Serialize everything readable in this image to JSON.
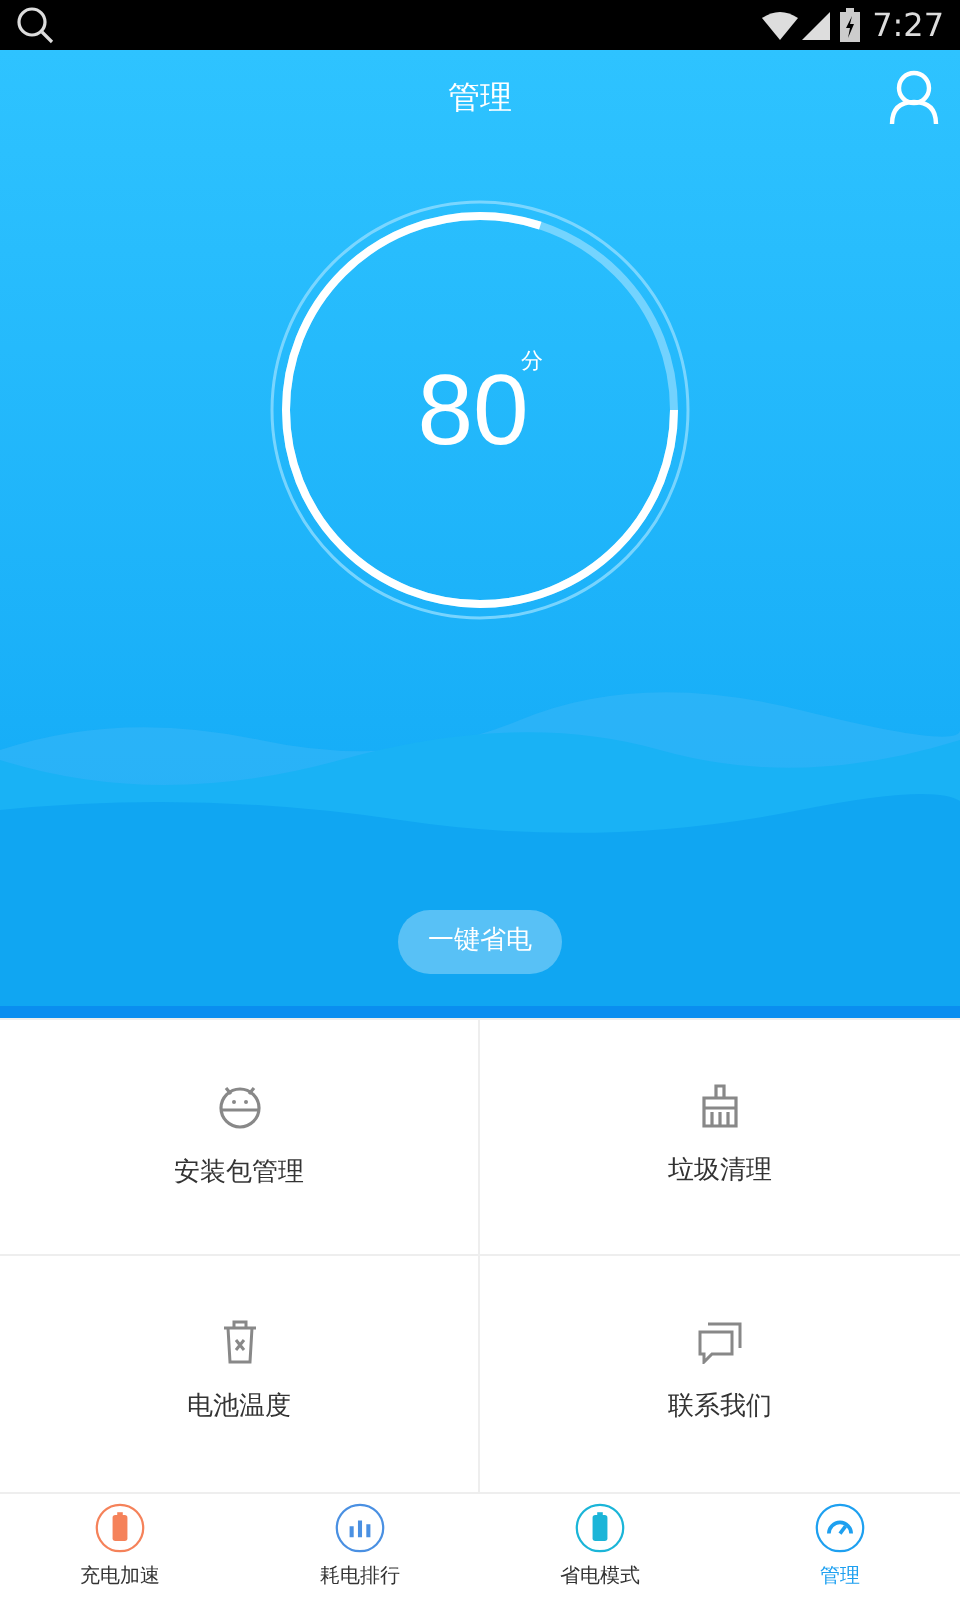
{
  "status_bar": {
    "time": "7:27"
  },
  "header": {
    "title": "管理"
  },
  "score": {
    "value": "80",
    "unit": "分",
    "level": 0.8
  },
  "action_button": {
    "label": "一键省电"
  },
  "grid": [
    {
      "label": "安装包管理",
      "kind": "android"
    },
    {
      "label": "垃圾清理",
      "kind": "broom"
    },
    {
      "label": "电池温度",
      "kind": "bin"
    },
    {
      "label": "联系我们",
      "kind": "chat"
    }
  ],
  "tabs": [
    {
      "label": "充电加速",
      "kind": "charge",
      "selected": false
    },
    {
      "label": "耗电排行",
      "kind": "rank",
      "selected": false
    },
    {
      "label": "省电模式",
      "kind": "save",
      "selected": false
    },
    {
      "label": "管理",
      "kind": "manage",
      "selected": true
    }
  ]
}
